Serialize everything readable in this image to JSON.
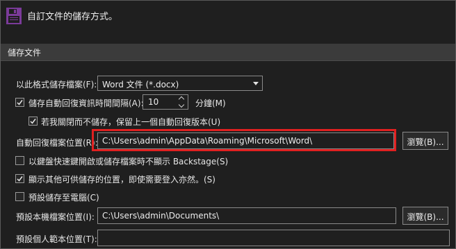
{
  "header": {
    "text": "自訂文件的儲存方式。",
    "icon": "save-icon"
  },
  "section": {
    "title": "儲存文件"
  },
  "format_row": {
    "label": "以此格式儲存檔案(F):",
    "value": "Word 文件 (*.docx)"
  },
  "autorecover_interval": {
    "label": "儲存自動回復資訊時間間隔(A):",
    "checked": true,
    "value": "10",
    "unit": "分鐘(M)"
  },
  "keep_last": {
    "label": "若我關閉而不儲存，保留上一個自動回復版本(U)",
    "checked": true
  },
  "autorecover_location": {
    "label": "自動回復檔案位置(R):",
    "value": "C:\\Users\\admin\\AppData\\Roaming\\Microsoft\\Word\\",
    "browse": "瀏覽(B)...",
    "highlight_color": "#e02020"
  },
  "backstage": {
    "label": "以鍵盤快速鍵開啟或儲存檔案時不顯示 Backstage(S)",
    "checked": false
  },
  "show_locations": {
    "label": "顯示其他可供儲存的位置，即使需要登入亦然。(S)",
    "checked": true
  },
  "save_to_computer": {
    "label": "預設儲存至電腦(C)",
    "checked": false
  },
  "local_location": {
    "label": "預設本機檔案位置(I):",
    "value": "C:\\Users\\admin\\Documents\\",
    "browse": "瀏覽(B)..."
  },
  "personal_templates": {
    "label": "預設個人範本位置(T):",
    "value": ""
  },
  "colors": {
    "background": "#1f1f1f",
    "section_bar": "#3b3b3b",
    "icon_purple": "#7b3b9a"
  }
}
